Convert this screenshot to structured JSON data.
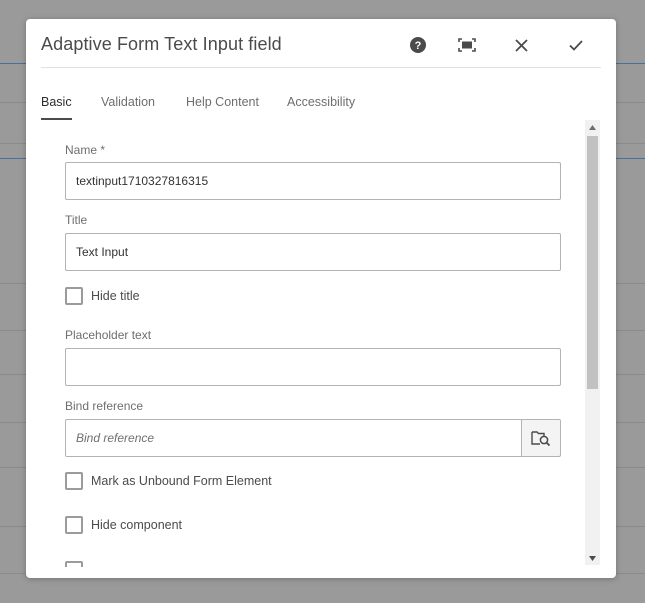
{
  "dialog": {
    "title": "Adaptive Form Text Input field",
    "help_icon": "help-circle-icon",
    "fullscreen_icon": "fullscreen-icon",
    "close_icon": "close-icon",
    "confirm_icon": "check-icon"
  },
  "tabs": [
    {
      "label": "Basic",
      "active": true
    },
    {
      "label": "Validation",
      "active": false
    },
    {
      "label": "Help Content",
      "active": false
    },
    {
      "label": "Accessibility",
      "active": false
    }
  ],
  "form": {
    "name": {
      "label": "Name *",
      "value": "textinput1710327816315"
    },
    "title": {
      "label": "Title",
      "value": "Text Input"
    },
    "hide_title": {
      "label": "Hide title",
      "checked": false
    },
    "placeholder": {
      "label": "Placeholder text",
      "value": ""
    },
    "bind_reference": {
      "label": "Bind reference",
      "placeholder": "Bind reference",
      "value": "",
      "browse_icon": "folder-search-icon"
    },
    "unbound": {
      "label": "Mark as Unbound Form Element",
      "checked": false
    },
    "hide_component": {
      "label": "Hide component",
      "checked": false
    }
  },
  "colors": {
    "overlay": "#9a9a9a",
    "dialog_bg": "#ffffff",
    "border": "#b3b3b3",
    "text": "#323232",
    "label": "#6e6e6e"
  }
}
